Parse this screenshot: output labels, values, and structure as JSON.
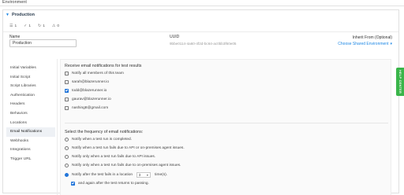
{
  "page": {
    "label": "Environment"
  },
  "env": {
    "name_heading": "Production",
    "counts": [
      {
        "icon": "user-icon",
        "glyph": "☰",
        "value": "1"
      },
      {
        "icon": "check-icon",
        "glyph": "✓",
        "value": "1"
      },
      {
        "icon": "refresh-icon",
        "glyph": "↻",
        "value": "1"
      },
      {
        "icon": "warning-icon",
        "glyph": "⚠",
        "value": "0"
      }
    ]
  },
  "fields": {
    "name_label": "Name",
    "name_value": "Production",
    "uuid_label": "UUID",
    "uuid_value": "9bbe0114-4a60-4f2d-bc64-ac0bb3f60e05",
    "inherit_label": "Inherit From (Optional)",
    "inherit_value": "Choose Shared Environment",
    "inherit_caret": "▾"
  },
  "sidebar": {
    "items": [
      {
        "label": "Initial Variables",
        "active": false
      },
      {
        "label": "Initial Script",
        "active": false
      },
      {
        "label": "Script Libraries",
        "active": false
      },
      {
        "label": "Authentication",
        "active": false
      },
      {
        "label": "Headers",
        "active": false
      },
      {
        "label": "Behaviors",
        "active": false
      },
      {
        "label": "Locations",
        "active": false
      },
      {
        "label": "Email Notifications",
        "active": true
      },
      {
        "label": "Webhooks",
        "active": false
      },
      {
        "label": "Integrations",
        "active": false
      },
      {
        "label": "Trigger URL",
        "active": false
      }
    ]
  },
  "email": {
    "section_title": "Receive email notifications for test results",
    "recipients": [
      {
        "label": "Notify all members of this team",
        "checked": false
      },
      {
        "label": "sarah@blazerunner.io",
        "checked": false
      },
      {
        "label": "todd@blazerunner.io",
        "checked": true
      },
      {
        "label": "gaurav@blazerunner.io",
        "checked": false
      },
      {
        "label": "nashing8@gmail.com",
        "checked": false
      }
    ],
    "frequency_title": "Select the frequency of email notifications:",
    "frequency": [
      {
        "label": "Notify when a test run is completed.",
        "selected": false
      },
      {
        "label": "Notify when a test run fails due to API or on-premises agent issues.",
        "selected": false
      },
      {
        "label": "Notify only when a test run fails due to API issues.",
        "selected": false
      },
      {
        "label": "Notify only when a test run fails due to on-premises agent issues.",
        "selected": false
      }
    ],
    "location_option": {
      "prefix": "Notify after the test fails in a location",
      "count": "3",
      "suffix": "time(s).",
      "selected": true
    },
    "passing": {
      "label": "and again after the test returns to passing.",
      "checked": true
    }
  },
  "help_tab": {
    "label": "HELP CENTER"
  },
  "colors": {
    "accent": "#1e73d9",
    "link": "#1e88e5",
    "help": "#3ab54a"
  }
}
